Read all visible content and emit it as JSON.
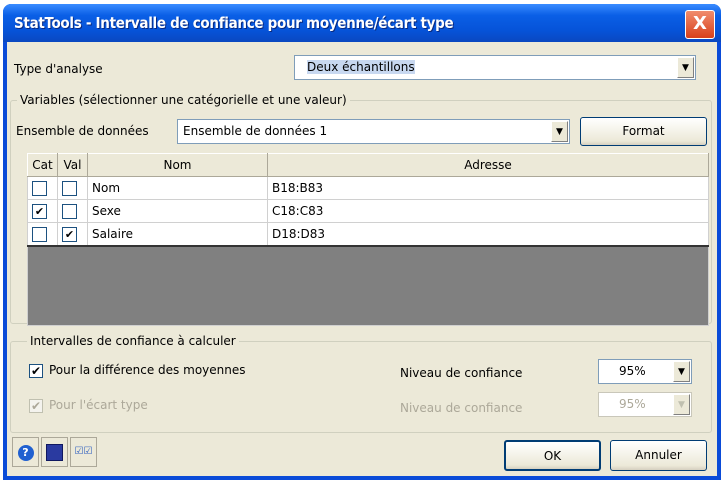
{
  "window": {
    "title": "StatTools - Intervalle de confiance pour moyenne/écart type",
    "close": "X"
  },
  "analysis": {
    "label": "Type d'analyse",
    "value": "Deux échantillons"
  },
  "variables": {
    "legend": "Variables (sélectionner une catégorielle et une valeur)",
    "dataset_label": "Ensemble de données",
    "dataset_value": "Ensemble de données 1",
    "format_button": "Format",
    "columns": [
      "Cat",
      "Val",
      "Nom",
      "Adresse"
    ],
    "rows": [
      {
        "cat": false,
        "val": false,
        "nom": "Nom",
        "adresse": "B18:B83"
      },
      {
        "cat": true,
        "val": false,
        "nom": "Sexe",
        "adresse": "C18:C83"
      },
      {
        "cat": false,
        "val": true,
        "nom": "Salaire",
        "adresse": "D18:D83"
      }
    ]
  },
  "intervals": {
    "legend": "Intervalles de confiance à calculer",
    "mean_diff_label": "Pour la différence des moyennes",
    "mean_diff_checked": true,
    "mean_level_label": "Niveau de confiance",
    "mean_level": "95%",
    "std_label": "Pour l'écart type",
    "std_checked": true,
    "std_level_label": "Niveau de confiance",
    "std_level": "95%"
  },
  "buttons": {
    "ok": "OK",
    "cancel": "Annuler"
  },
  "icons": [
    "help-icon",
    "save-icon",
    "checkboxes-icon"
  ]
}
